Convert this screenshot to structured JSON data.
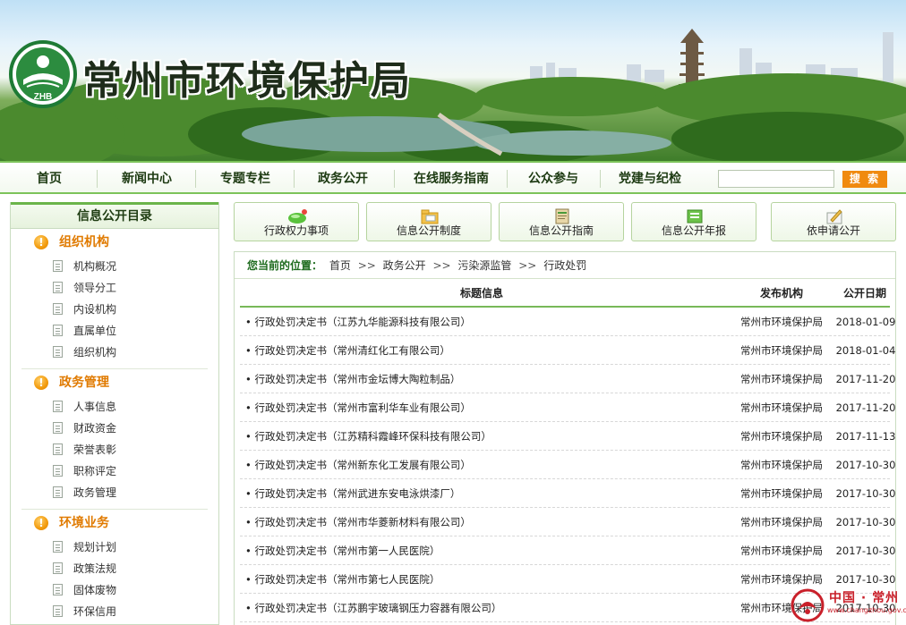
{
  "header": {
    "site_title": "常州市环境保护局",
    "logo_text": "ZHB"
  },
  "nav": {
    "items": [
      "首页",
      "新闻中心",
      "专题专栏",
      "政务公开",
      "在线服务指南",
      "公众参与",
      "党建与纪检"
    ],
    "search_placeholder": "",
    "search_button": "搜 索"
  },
  "sidebar": {
    "title": "信息公开目录",
    "sections": [
      {
        "title": "组织机构",
        "items": [
          "机构概况",
          "领导分工",
          "内设机构",
          "直属单位",
          "组织机构"
        ]
      },
      {
        "title": "政务管理",
        "items": [
          "人事信息",
          "财政资金",
          "荣誉表彰",
          "职称评定",
          "政务管理"
        ]
      },
      {
        "title": "环境业务",
        "items": [
          "规划计划",
          "政策法规",
          "固体废物",
          "环保信用"
        ]
      }
    ]
  },
  "quick_buttons": [
    "行政权力事项",
    "信息公开制度",
    "信息公开指南",
    "信息公开年报",
    "依申请公开"
  ],
  "breadcrumb": {
    "lead": "您当前的位置：",
    "items": [
      "首页",
      "政务公开",
      "污染源监管",
      "行政处罚"
    ],
    "separator": ">>"
  },
  "table": {
    "headers": {
      "title": "标题信息",
      "org": "发布机构",
      "date": "公开日期"
    },
    "rows": [
      {
        "title": "• 行政处罚决定书（江苏九华能源科技有限公司）",
        "org": "常州市环境保护局",
        "date": "2018-01-09"
      },
      {
        "title": "• 行政处罚决定书（常州清红化工有限公司）",
        "org": "常州市环境保护局",
        "date": "2018-01-04"
      },
      {
        "title": "• 行政处罚决定书（常州市金坛博大陶粒制品）",
        "org": "常州市环境保护局",
        "date": "2017-11-20"
      },
      {
        "title": "•  行政处罚决定书（常州市富利华车业有限公司）",
        "org": "常州市环境保护局",
        "date": "2017-11-20"
      },
      {
        "title": "• 行政处罚决定书（江苏精科霞峰环保科技有限公司）",
        "org": "常州市环境保护局",
        "date": "2017-11-13"
      },
      {
        "title": "• 行政处罚决定书（常州新东化工发展有限公司）",
        "org": "常州市环境保护局",
        "date": "2017-10-30"
      },
      {
        "title": "• 行政处罚决定书（常州武进东安电泳烘漆厂）",
        "org": "常州市环境保护局",
        "date": "2017-10-30"
      },
      {
        "title": "• 行政处罚决定书（常州市华菱新材料有限公司）",
        "org": "常州市环境保护局",
        "date": "2017-10-30"
      },
      {
        "title": "• 行政处罚决定书（常州市第一人民医院）",
        "org": "常州市环境保护局",
        "date": "2017-10-30"
      },
      {
        "title": "• 行政处罚决定书（常州市第七人民医院）",
        "org": "常州市环境保护局",
        "date": "2017-10-30"
      },
      {
        "title": "• 行政处罚决定书（江苏鹏宇玻璃钢压力容器有限公司）",
        "org": "常州市环境保护局",
        "date": "2017-10-30"
      }
    ]
  },
  "watermark": {
    "text": "中国 · 常州",
    "url": "www.changzhou.gov.cn"
  },
  "colors": {
    "accent_green": "#6bb44a",
    "section_orange": "#e07a00",
    "search_orange": "#f08a0f"
  }
}
